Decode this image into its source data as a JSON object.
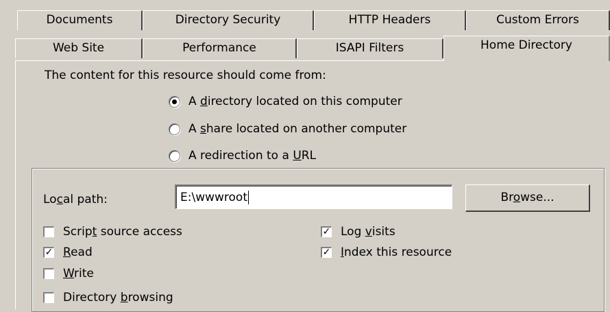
{
  "tabs_row1": [
    {
      "label": "Documents"
    },
    {
      "label": "Directory Security"
    },
    {
      "label": "HTTP Headers"
    },
    {
      "label": "Custom Errors"
    }
  ],
  "tabs_row2": [
    {
      "label": "Web Site"
    },
    {
      "label": "Performance"
    },
    {
      "label": "ISAPI Filters"
    },
    {
      "label": "Home Directory",
      "active": true
    }
  ],
  "content_source": {
    "intro": "The content for this resource should come from:",
    "options": [
      {
        "pre": "A ",
        "accel": "d",
        "post": "irectory located on this computer",
        "selected": true
      },
      {
        "pre": "A ",
        "accel": "s",
        "post": "hare located on another computer",
        "selected": false
      },
      {
        "pre": "A redirection to a ",
        "accel": "U",
        "post": "RL",
        "selected": false
      }
    ]
  },
  "local_path": {
    "label_pre": "Lo",
    "label_accel": "c",
    "label_post": "al path:",
    "value": "E:\\wwwroot"
  },
  "browse_button": {
    "pre": "Br",
    "accel": "o",
    "post": "wse..."
  },
  "checkboxes_left": [
    {
      "pre": "Scrip",
      "accel": "t",
      "post": " source access",
      "checked": false
    },
    {
      "pre": "",
      "accel": "R",
      "post": "ead",
      "checked": true
    },
    {
      "pre": "",
      "accel": "W",
      "post": "rite",
      "checked": false
    },
    {
      "pre": "Directory ",
      "accel": "b",
      "post": "rowsing",
      "checked": false
    }
  ],
  "checkboxes_right": [
    {
      "pre": "Log ",
      "accel": "v",
      "post": "isits",
      "checked": true
    },
    {
      "pre": "",
      "accel": "I",
      "post": "ndex this resource",
      "checked": true
    }
  ]
}
